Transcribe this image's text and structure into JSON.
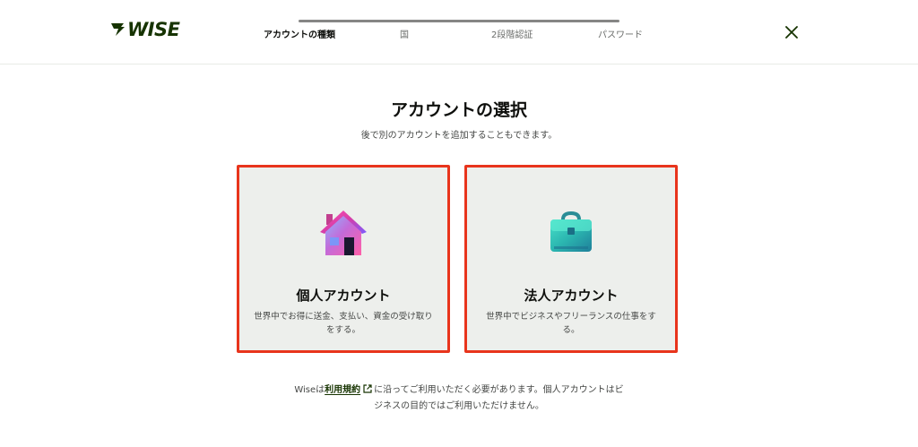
{
  "header": {
    "logo_text": "WISE",
    "steps": [
      {
        "label": "アカウントの種類",
        "active": true
      },
      {
        "label": "国",
        "active": false
      },
      {
        "label": "2段階認証",
        "active": false
      },
      {
        "label": "パスワード",
        "active": false
      }
    ],
    "close_icon": "close-icon"
  },
  "main": {
    "title": "アカウントの選択",
    "subtitle": "後で別のアカウントを追加することもできます。"
  },
  "cards": [
    {
      "title": "個人アカウント",
      "description_line1": "世界中でお得に送金、支払い、資金の受け取り",
      "description_line2": "をする。",
      "icon": "house-icon"
    },
    {
      "title": "法人アカウント",
      "description_line1": "世界中でビジネスやフリーランスの仕事をす",
      "description_line2": "る。",
      "icon": "briefcase-icon"
    }
  ],
  "footer": {
    "prefix": "Wiseは",
    "link_text": "利用規約",
    "line1_rest": "に沿ってご利用いただく必要があります。個人アカウントはビ",
    "line2": "ジネスの目的ではご利用いただけません。"
  },
  "colors": {
    "brand": "#163300",
    "highlight_border": "#e8341c",
    "card_bg": "#edefec"
  }
}
